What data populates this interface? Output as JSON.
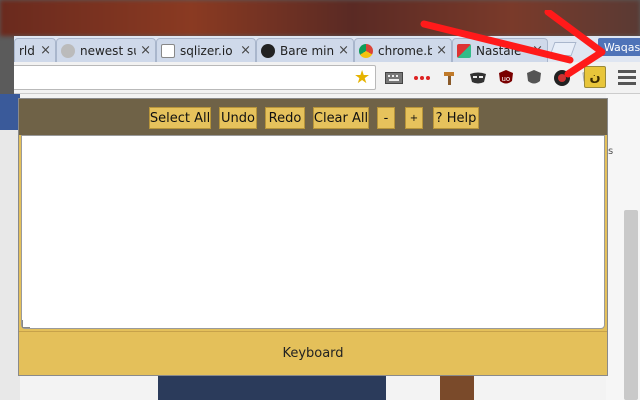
{
  "browser": {
    "tabs": [
      {
        "label": "rld",
        "close": "×"
      },
      {
        "label": "newest su",
        "close": "×"
      },
      {
        "label": "sqlizer.io",
        "close": "×"
      },
      {
        "label": "Bare mini",
        "close": "×"
      },
      {
        "label": "chrome.br",
        "close": "×"
      },
      {
        "label": "Nastale",
        "close": "×"
      }
    ],
    "profile_name": "Waqas",
    "omnibox_value": "",
    "star_glyph": "★",
    "extensions": [
      "keyboard-icon",
      "dots-icon",
      "hammer-icon",
      "mask-icon",
      "ublock-icon",
      "shield-icon",
      "record-icon",
      "vpn-icon",
      "urdu-keyboard-icon"
    ],
    "urdu_glyph": "ن",
    "accent_color": "#e6c25c"
  },
  "popup": {
    "buttons": {
      "select_all": "Select All",
      "undo": "Undo",
      "redo": "Redo",
      "clear_all": "Clear All",
      "font_minus": "-",
      "font_plus": "+",
      "help": "? Help"
    },
    "editor_text": "",
    "keyboard_label": "Keyboard"
  },
  "page_side": {
    "fragment": "s"
  }
}
